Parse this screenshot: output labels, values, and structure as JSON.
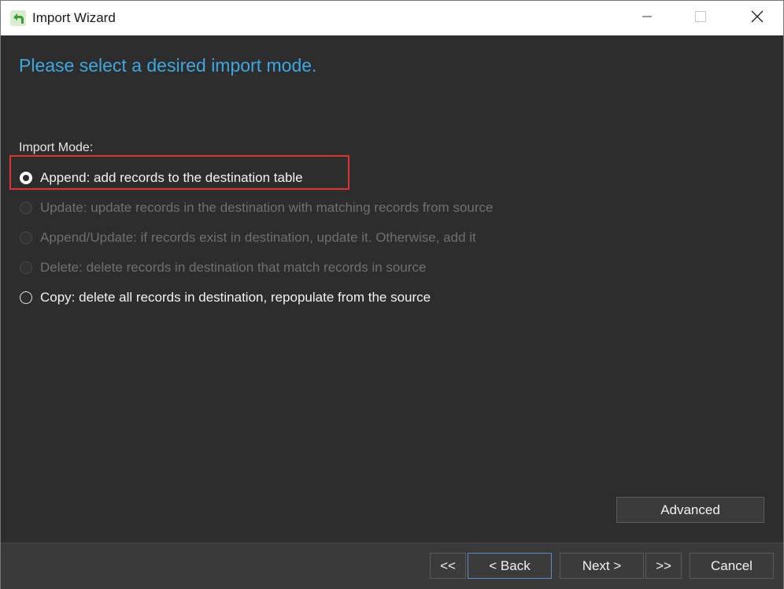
{
  "window": {
    "title": "Import Wizard",
    "icons": {
      "app": "back-arrow-icon",
      "minimize": "minimize-icon",
      "maximize": "maximize-icon",
      "close": "close-icon"
    }
  },
  "main": {
    "heading": "Please select a desired import mode.",
    "mode_label": "Import Mode:",
    "options": [
      {
        "label": "Append: add records to the destination table",
        "selected": true,
        "enabled": true
      },
      {
        "label": "Update: update records in the destination with matching records from source",
        "selected": false,
        "enabled": false
      },
      {
        "label": "Append/Update: if records exist in destination, update it. Otherwise, add it",
        "selected": false,
        "enabled": false
      },
      {
        "label": "Delete: delete records in destination that match records in source",
        "selected": false,
        "enabled": false
      },
      {
        "label": "Copy: delete all records in destination, repopulate from the source",
        "selected": false,
        "enabled": true
      }
    ],
    "advanced_label": "Advanced"
  },
  "footer": {
    "first_label": "<<",
    "back_label": "< Back",
    "next_label": "Next >",
    "last_label": ">>",
    "cancel_label": "Cancel"
  },
  "colors": {
    "heading": "#3fa7e0",
    "background": "#2d2d2d",
    "highlight": "#e0322f"
  }
}
